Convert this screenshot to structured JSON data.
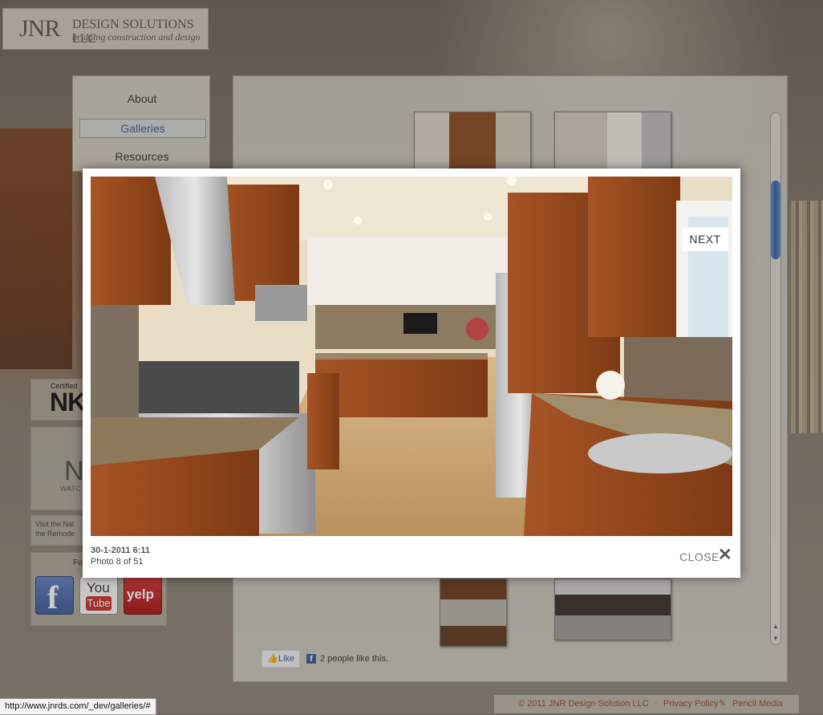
{
  "brand": {
    "mark": "JNR",
    "name": "DESIGN SOLUTIONS LLC",
    "tagline": "bridging construction and design"
  },
  "nav": {
    "items": [
      {
        "label": "About"
      },
      {
        "label": "Galleries",
        "active": true
      },
      {
        "label": "Resources"
      }
    ]
  },
  "sidebar": {
    "certified_text": "Certified",
    "nkba_text": "NK",
    "n_text": "N",
    "watch_text": "WATC",
    "visit_text": "Visit the Nat the Remode",
    "follow_text": "Fo"
  },
  "social": {
    "facebook_icon": "f",
    "youtube_you": "You",
    "youtube_tube": "Tube",
    "yelp_icon": "yelp"
  },
  "facebook_like": {
    "button_label": "Like",
    "fb_icon": "f",
    "count_text": "2 people like this."
  },
  "lightbox": {
    "next_label": "NEXT",
    "close_label": "CLOSE",
    "close_icon": "✕",
    "caption_date": "30-1-2011 6:11",
    "caption_count": "Photo 8 of 51"
  },
  "footer": {
    "copyright": "© 2011 JNR Design Solution LLC",
    "sep1": "·",
    "privacy": "Privacy Policy",
    "sep2": "·",
    "credit": "Pencil Media"
  },
  "status_bar": {
    "url": "http://www.jnrds.com/_dev/galleries/#"
  },
  "colors": {
    "accent_link": "#3b5998",
    "footer_text": "#a2432a",
    "scroll_thumb": "#2c5fa8"
  }
}
